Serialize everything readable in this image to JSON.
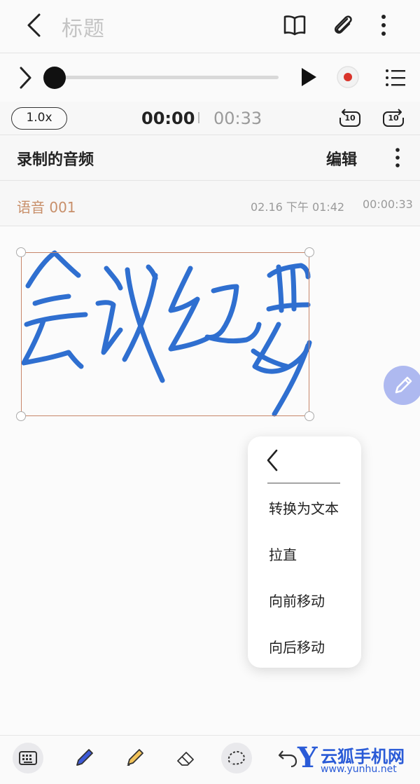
{
  "header": {
    "title": "标题",
    "back_icon": "back-arrow-icon",
    "book_icon": "book-icon",
    "attach_icon": "paperclip-icon",
    "more_icon": "more-vertical-icon"
  },
  "player": {
    "progress": 0,
    "speed": "1.0x",
    "current_time": "00:00",
    "total_time": "00:33",
    "skip_back": "10",
    "skip_forward": "10",
    "accent": "#d9342b"
  },
  "recordings": {
    "section_label": "录制的音频",
    "edit_label": "编辑",
    "item": {
      "name": "语音 001",
      "date": "02.16 下午 01:42",
      "duration": "00:00:33"
    }
  },
  "context_menu": {
    "items": [
      "转换为文本",
      "拉直",
      "向前移动",
      "向后移动"
    ]
  },
  "watermark": {
    "logo": "Y",
    "text": "云狐手机网",
    "url": "www.yunhu.net"
  },
  "colors": {
    "handwriting": "#2f6fd0",
    "selection": "#c7866a",
    "recording_name": "#c88f6a",
    "fab": "#aeb9f0"
  }
}
